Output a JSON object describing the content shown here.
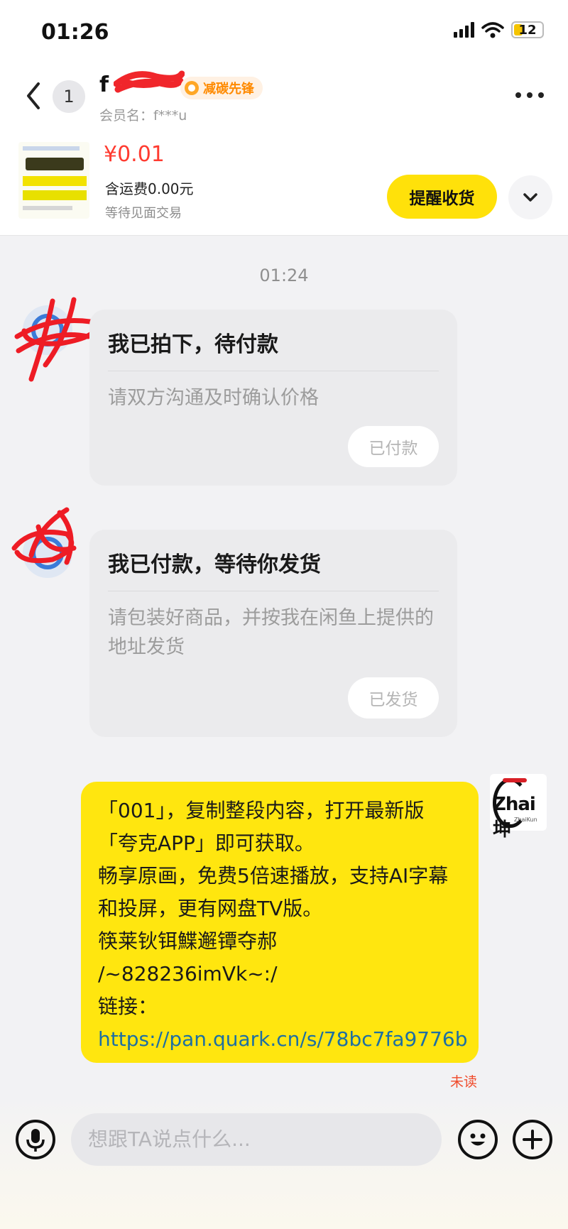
{
  "status_bar": {
    "time": "01:26",
    "battery": "12"
  },
  "header": {
    "unread_count": "1",
    "nickname": "f",
    "badge": "减碳先锋",
    "member_name": "会员名：f***u"
  },
  "item": {
    "price": "¥0.01",
    "shipping": "含运费0.00元",
    "status": "等待见面交易",
    "remind_button": "提醒收货"
  },
  "chat": {
    "time_separator": "01:24",
    "cards": [
      {
        "title": "我已拍下，待付款",
        "desc": "请双方沟通及时确认价格",
        "button": "已付款"
      },
      {
        "title": "我已付款，等待你发货",
        "desc": "请包装好商品，并按我在闲鱼上提供的地址发货",
        "button": "已发货"
      }
    ],
    "my_message": {
      "text": "「001」，复制整段内容，打开最新版「夸克APP」即可获取。\n畅享原画，免费5倍速播放，支持AI字幕和投屏，更有网盘TV版。\n筷莱钬铒鰈邂镡夺郝\n/~828236imVk~:/",
      "link_label": "链接：",
      "link": "https://pan.quark.cn/s/78bc7fa9776b"
    },
    "self_avatar_text": "Zhai坤",
    "self_avatar_sub": "ZhaiKun",
    "read_status": "未读"
  },
  "input": {
    "placeholder": "想跟TA说点什么..."
  },
  "colors": {
    "accent_yellow": "#ffe10a",
    "price_red": "#ff3b30",
    "link_blue": "#1d6fa3",
    "badge_orange": "#ff8a00"
  }
}
